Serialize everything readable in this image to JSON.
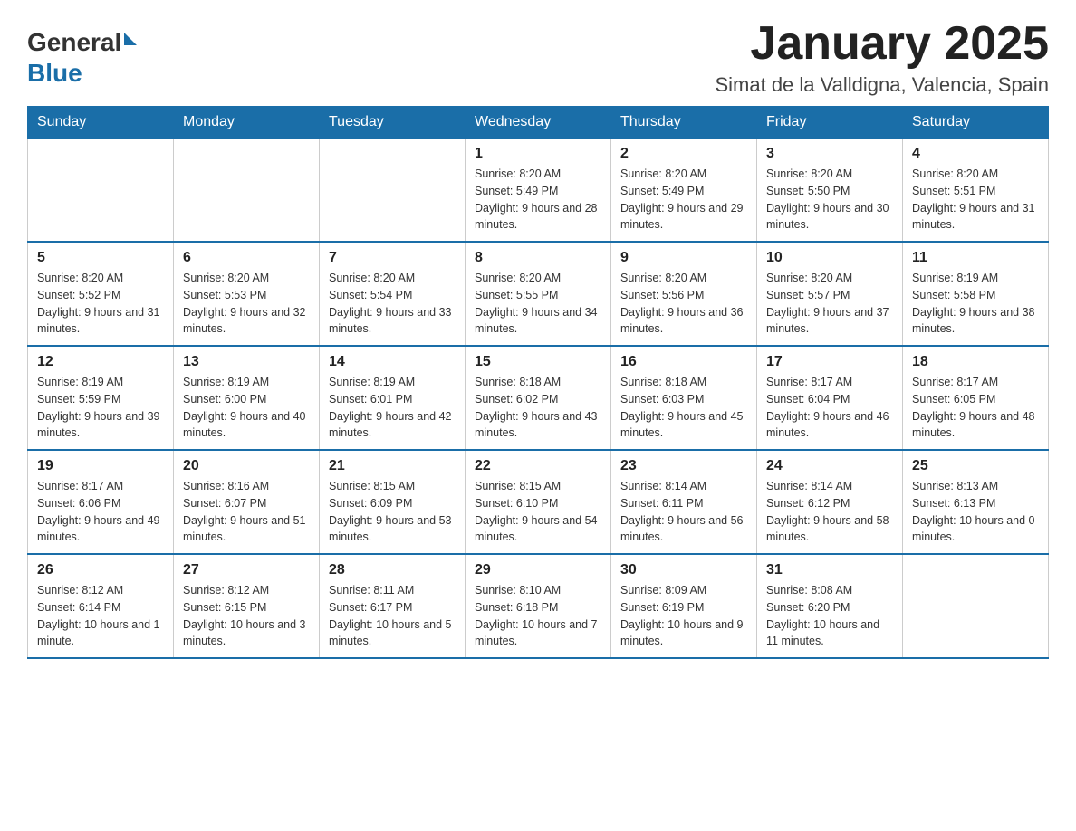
{
  "header": {
    "logo_general": "General",
    "logo_blue": "Blue",
    "calendar_title": "January 2025",
    "location": "Simat de la Valldigna, Valencia, Spain"
  },
  "days_of_week": [
    "Sunday",
    "Monday",
    "Tuesday",
    "Wednesday",
    "Thursday",
    "Friday",
    "Saturday"
  ],
  "weeks": [
    [
      {
        "day": "",
        "info": ""
      },
      {
        "day": "",
        "info": ""
      },
      {
        "day": "",
        "info": ""
      },
      {
        "day": "1",
        "info": "Sunrise: 8:20 AM\nSunset: 5:49 PM\nDaylight: 9 hours and 28 minutes."
      },
      {
        "day": "2",
        "info": "Sunrise: 8:20 AM\nSunset: 5:49 PM\nDaylight: 9 hours and 29 minutes."
      },
      {
        "day": "3",
        "info": "Sunrise: 8:20 AM\nSunset: 5:50 PM\nDaylight: 9 hours and 30 minutes."
      },
      {
        "day": "4",
        "info": "Sunrise: 8:20 AM\nSunset: 5:51 PM\nDaylight: 9 hours and 31 minutes."
      }
    ],
    [
      {
        "day": "5",
        "info": "Sunrise: 8:20 AM\nSunset: 5:52 PM\nDaylight: 9 hours and 31 minutes."
      },
      {
        "day": "6",
        "info": "Sunrise: 8:20 AM\nSunset: 5:53 PM\nDaylight: 9 hours and 32 minutes."
      },
      {
        "day": "7",
        "info": "Sunrise: 8:20 AM\nSunset: 5:54 PM\nDaylight: 9 hours and 33 minutes."
      },
      {
        "day": "8",
        "info": "Sunrise: 8:20 AM\nSunset: 5:55 PM\nDaylight: 9 hours and 34 minutes."
      },
      {
        "day": "9",
        "info": "Sunrise: 8:20 AM\nSunset: 5:56 PM\nDaylight: 9 hours and 36 minutes."
      },
      {
        "day": "10",
        "info": "Sunrise: 8:20 AM\nSunset: 5:57 PM\nDaylight: 9 hours and 37 minutes."
      },
      {
        "day": "11",
        "info": "Sunrise: 8:19 AM\nSunset: 5:58 PM\nDaylight: 9 hours and 38 minutes."
      }
    ],
    [
      {
        "day": "12",
        "info": "Sunrise: 8:19 AM\nSunset: 5:59 PM\nDaylight: 9 hours and 39 minutes."
      },
      {
        "day": "13",
        "info": "Sunrise: 8:19 AM\nSunset: 6:00 PM\nDaylight: 9 hours and 40 minutes."
      },
      {
        "day": "14",
        "info": "Sunrise: 8:19 AM\nSunset: 6:01 PM\nDaylight: 9 hours and 42 minutes."
      },
      {
        "day": "15",
        "info": "Sunrise: 8:18 AM\nSunset: 6:02 PM\nDaylight: 9 hours and 43 minutes."
      },
      {
        "day": "16",
        "info": "Sunrise: 8:18 AM\nSunset: 6:03 PM\nDaylight: 9 hours and 45 minutes."
      },
      {
        "day": "17",
        "info": "Sunrise: 8:17 AM\nSunset: 6:04 PM\nDaylight: 9 hours and 46 minutes."
      },
      {
        "day": "18",
        "info": "Sunrise: 8:17 AM\nSunset: 6:05 PM\nDaylight: 9 hours and 48 minutes."
      }
    ],
    [
      {
        "day": "19",
        "info": "Sunrise: 8:17 AM\nSunset: 6:06 PM\nDaylight: 9 hours and 49 minutes."
      },
      {
        "day": "20",
        "info": "Sunrise: 8:16 AM\nSunset: 6:07 PM\nDaylight: 9 hours and 51 minutes."
      },
      {
        "day": "21",
        "info": "Sunrise: 8:15 AM\nSunset: 6:09 PM\nDaylight: 9 hours and 53 minutes."
      },
      {
        "day": "22",
        "info": "Sunrise: 8:15 AM\nSunset: 6:10 PM\nDaylight: 9 hours and 54 minutes."
      },
      {
        "day": "23",
        "info": "Sunrise: 8:14 AM\nSunset: 6:11 PM\nDaylight: 9 hours and 56 minutes."
      },
      {
        "day": "24",
        "info": "Sunrise: 8:14 AM\nSunset: 6:12 PM\nDaylight: 9 hours and 58 minutes."
      },
      {
        "day": "25",
        "info": "Sunrise: 8:13 AM\nSunset: 6:13 PM\nDaylight: 10 hours and 0 minutes."
      }
    ],
    [
      {
        "day": "26",
        "info": "Sunrise: 8:12 AM\nSunset: 6:14 PM\nDaylight: 10 hours and 1 minute."
      },
      {
        "day": "27",
        "info": "Sunrise: 8:12 AM\nSunset: 6:15 PM\nDaylight: 10 hours and 3 minutes."
      },
      {
        "day": "28",
        "info": "Sunrise: 8:11 AM\nSunset: 6:17 PM\nDaylight: 10 hours and 5 minutes."
      },
      {
        "day": "29",
        "info": "Sunrise: 8:10 AM\nSunset: 6:18 PM\nDaylight: 10 hours and 7 minutes."
      },
      {
        "day": "30",
        "info": "Sunrise: 8:09 AM\nSunset: 6:19 PM\nDaylight: 10 hours and 9 minutes."
      },
      {
        "day": "31",
        "info": "Sunrise: 8:08 AM\nSunset: 6:20 PM\nDaylight: 10 hours and 11 minutes."
      },
      {
        "day": "",
        "info": ""
      }
    ]
  ]
}
